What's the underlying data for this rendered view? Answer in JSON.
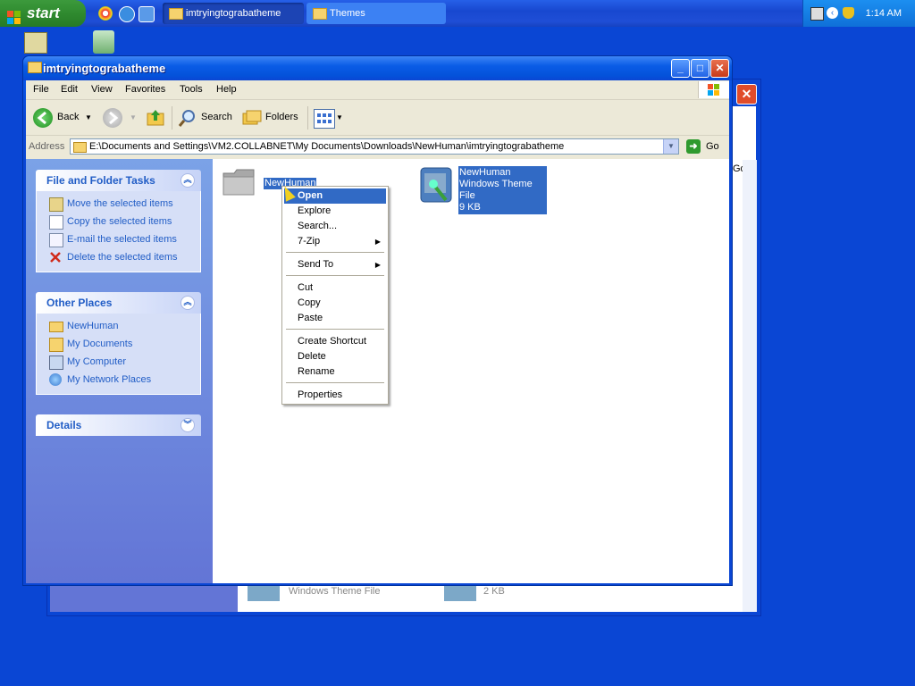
{
  "taskbar": {
    "start_label": "start",
    "tasks": [
      {
        "label": "imtryingtograbatheme",
        "active": true
      },
      {
        "label": "Themes",
        "active": false
      }
    ],
    "clock": "1:14 AM"
  },
  "back_window": {
    "footer_left": "Windows Theme File",
    "footer_right": "2 KB"
  },
  "window": {
    "title": "imtryingtograbatheme",
    "menu": [
      "File",
      "Edit",
      "View",
      "Favorites",
      "Tools",
      "Help"
    ],
    "toolbar": {
      "back": "Back",
      "search": "Search",
      "folders": "Folders"
    },
    "address": {
      "label": "Address",
      "value": "E:\\Documents and Settings\\VM2.COLLABNET\\My Documents\\Downloads\\NewHuman\\imtryingtograbatheme",
      "go": "Go"
    }
  },
  "tasks_pane": {
    "file_tasks": {
      "title": "File and Folder Tasks",
      "items": [
        "Move the selected items",
        "Copy the selected items",
        "E-mail the selected items",
        "Delete the selected items"
      ]
    },
    "other_places": {
      "title": "Other Places",
      "items": [
        "NewHuman",
        "My Documents",
        "My Computer",
        "My Network Places"
      ]
    },
    "details": {
      "title": "Details"
    }
  },
  "files": [
    {
      "name": "NewHuman",
      "type": "folder"
    },
    {
      "name": "NewHuman",
      "type_label": "Windows Theme File",
      "size": "9 KB"
    }
  ],
  "context_menu": {
    "items": [
      {
        "label": "Open",
        "highlighted": true
      },
      {
        "label": "Explore"
      },
      {
        "label": "Search..."
      },
      {
        "label": "7-Zip",
        "submenu": true
      },
      {
        "label": "Send To",
        "submenu": true
      },
      {
        "label": "Cut"
      },
      {
        "label": "Copy"
      },
      {
        "label": "Paste"
      },
      {
        "label": "Create Shortcut"
      },
      {
        "label": "Delete"
      },
      {
        "label": "Rename"
      },
      {
        "label": "Properties"
      }
    ]
  },
  "colors": {
    "desktop": "#0a46d4",
    "selection": "#316ac5",
    "link": "#215dc6"
  }
}
